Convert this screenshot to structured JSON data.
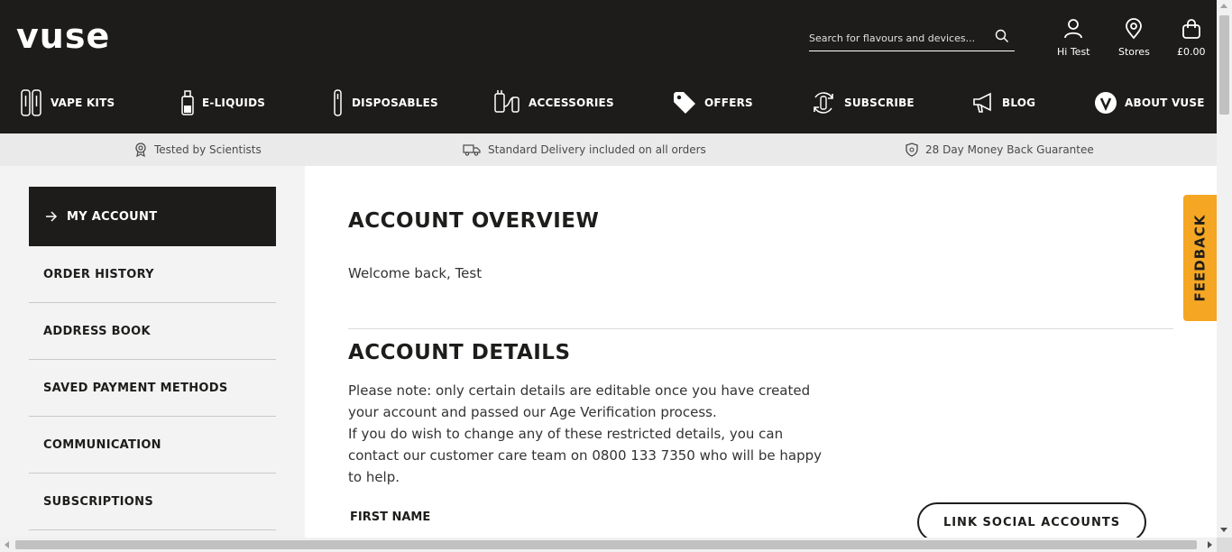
{
  "header": {
    "logo": "vuse",
    "search_placeholder": "Search for flavours and devices...",
    "account_label": "Hi Test",
    "stores_label": "Stores",
    "cart_label": "£0.00"
  },
  "nav": [
    {
      "label": "VAPE KITS",
      "icon": "vape-kits-icon"
    },
    {
      "label": "E-LIQUIDS",
      "icon": "e-liquid-icon"
    },
    {
      "label": "DISPOSABLES",
      "icon": "disposable-icon"
    },
    {
      "label": "ACCESSORIES",
      "icon": "accessories-icon"
    },
    {
      "label": "OFFERS",
      "icon": "tag-icon"
    },
    {
      "label": "SUBSCRIBE",
      "icon": "subscribe-icon"
    },
    {
      "label": "BLOG",
      "icon": "megaphone-icon"
    },
    {
      "label": "ABOUT VUSE",
      "icon": "vuse-badge-icon"
    }
  ],
  "usp": [
    {
      "label": "Tested by Scientists",
      "icon": "award-icon"
    },
    {
      "label": "Standard Delivery included on all orders",
      "icon": "truck-icon"
    },
    {
      "label": "28 Day Money Back Guarantee",
      "icon": "shield-icon"
    }
  ],
  "sidebar": {
    "active": "MY ACCOUNT",
    "items": [
      "ORDER HISTORY",
      "ADDRESS BOOK",
      "SAVED PAYMENT METHODS",
      "COMMUNICATION",
      "SUBSCRIPTIONS"
    ]
  },
  "main": {
    "overview_title": "ACCOUNT OVERVIEW",
    "welcome": "Welcome back, Test",
    "details_title": "ACCOUNT DETAILS",
    "note_lines": [
      "Please note: only certain details are editable once you have created",
      "your account and passed our Age Verification process.",
      "If you do wish to change any of these restricted details, you can",
      "contact our customer care team on 0800 133 7350 who will be happy",
      "to help."
    ],
    "first_name_label": "FIRST NAME",
    "link_social_label": "LINK SOCIAL ACCOUNTS"
  },
  "feedback_label": "FEEDBACK",
  "colors": {
    "header_bg": "#1d1c1a",
    "feedback_bg": "#f5a623",
    "usp_bg": "#eaeaea"
  }
}
